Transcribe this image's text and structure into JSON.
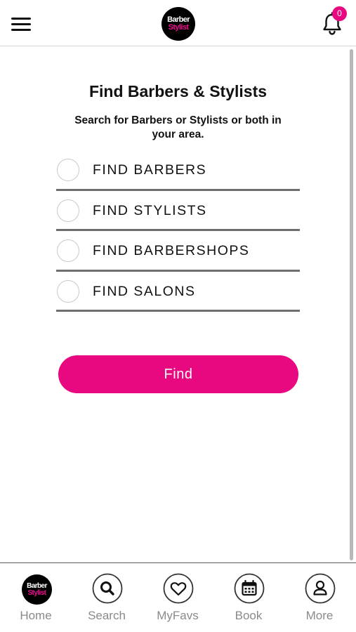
{
  "header": {
    "logo_line1": "Barber",
    "logo_line2": "Stylist",
    "notification_count": "0"
  },
  "main": {
    "title": "Find Barbers & Stylists",
    "subtitle": "Search for Barbers or Stylists or both in your area.",
    "options": [
      {
        "label": "FIND BARBERS",
        "selected": false
      },
      {
        "label": "FIND STYLISTS",
        "selected": false
      },
      {
        "label": "FIND BARBERSHOPS",
        "selected": false
      },
      {
        "label": "FIND SALONS",
        "selected": false
      }
    ],
    "find_button_label": "Find"
  },
  "bottom_nav": {
    "items": [
      {
        "label": "Home",
        "icon": "barber-stylist-logo"
      },
      {
        "label": "Search",
        "icon": "search-icon"
      },
      {
        "label": "MyFavs",
        "icon": "heart-icon"
      },
      {
        "label": "Book",
        "icon": "calendar-icon"
      },
      {
        "label": "More",
        "icon": "user-icon"
      }
    ],
    "home_logo_line1": "Barber",
    "home_logo_line2": "Stylist"
  },
  "colors": {
    "accent": "#e8087f",
    "nav_label": "#8a8a8a"
  }
}
